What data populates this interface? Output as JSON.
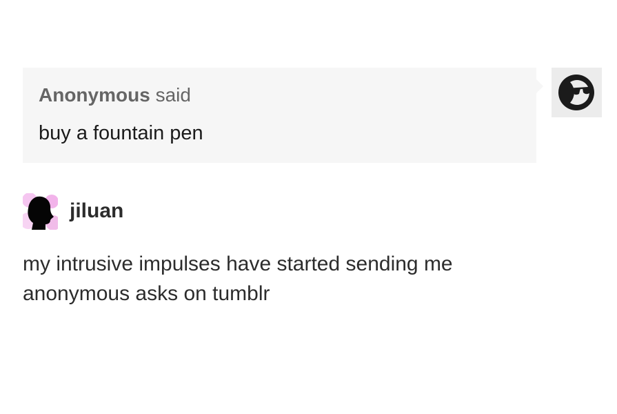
{
  "ask": {
    "sender": "Anonymous",
    "said_label": "said",
    "question": "buy a fountain pen"
  },
  "asker_avatar": {
    "icon": "anonymous-sunglasses-face-icon"
  },
  "answer": {
    "username": "jiluan",
    "avatar_icon": "silhouette-head-icon",
    "avatar_background": "#f5c6f0",
    "lines": [
      "my intrusive impulses have started sending me",
      "anonymous asks on tumblr"
    ]
  },
  "colors": {
    "bubble": "#f6f6f6",
    "sender_text": "#656565",
    "body_text": "#1b1b1b",
    "answer_text": "#2c2c2c"
  }
}
